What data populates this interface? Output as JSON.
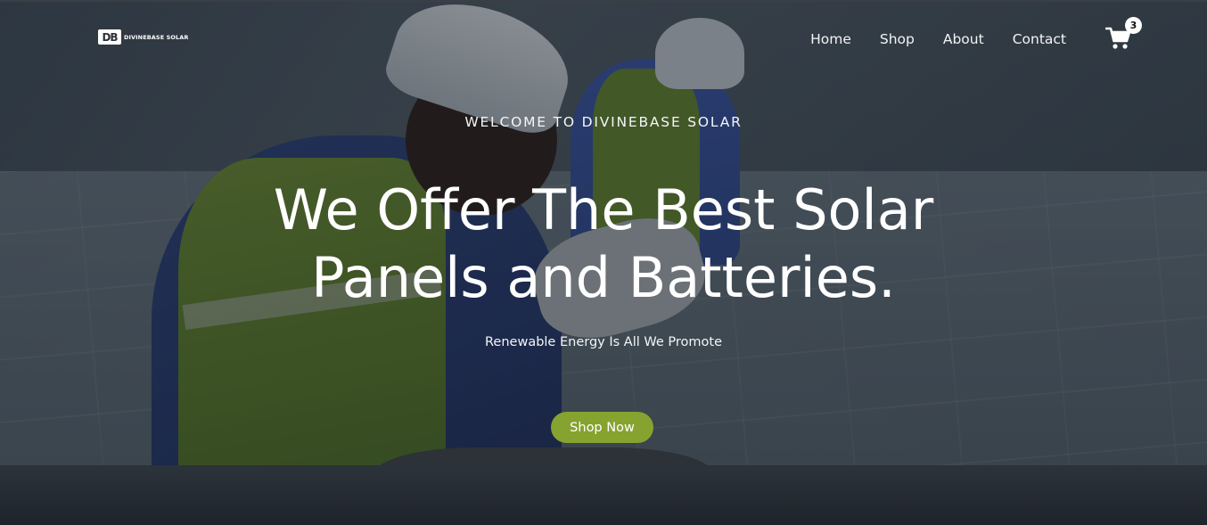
{
  "brand": {
    "logo_mark": "DB",
    "logo_text": "DIVINEBASE SOLAR"
  },
  "nav": {
    "items": [
      {
        "label": "Home"
      },
      {
        "label": "Shop"
      },
      {
        "label": "About"
      },
      {
        "label": "Contact"
      }
    ],
    "cart_icon": "shopping-cart-icon",
    "cart_count": "3"
  },
  "hero": {
    "eyebrow": "WELCOME TO DIVINEBASE SOLAR",
    "headline_line1": "We Offer The Best Solar",
    "headline_line2": "Panels and Batteries.",
    "subline": "Renewable Energy Is All We Promote",
    "cta_label": "Shop Now"
  },
  "colors": {
    "accent": "#86a330",
    "text": "#ffffff"
  }
}
